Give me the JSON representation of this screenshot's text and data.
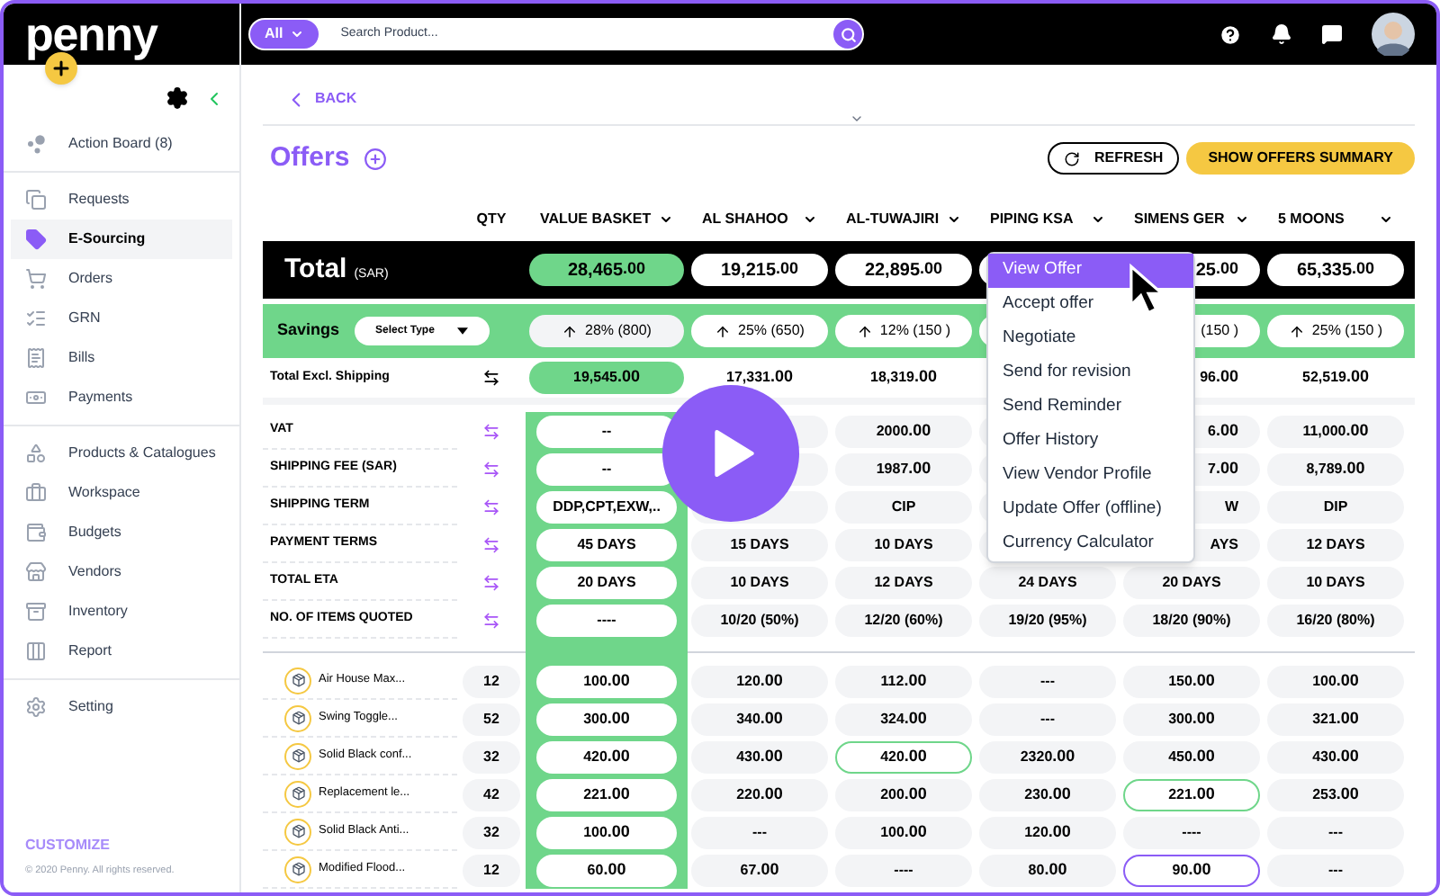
{
  "sidebar": {
    "logo": "penny",
    "groups": [
      [
        {
          "label": "Action Board (8)",
          "selected": false
        }
      ],
      [
        {
          "label": "Requests",
          "selected": false
        },
        {
          "label": "E-Sourcing",
          "selected": true
        },
        {
          "label": "Orders",
          "selected": false
        },
        {
          "label": "GRN",
          "selected": false
        },
        {
          "label": "Bills",
          "selected": false
        },
        {
          "label": "Payments",
          "selected": false
        }
      ],
      [
        {
          "label": "Products & Catalogues",
          "selected": false
        },
        {
          "label": "Workspace",
          "selected": false
        },
        {
          "label": "Budgets",
          "selected": false
        },
        {
          "label": "Vendors",
          "selected": false
        },
        {
          "label": "Inventory",
          "selected": false
        },
        {
          "label": "Report",
          "selected": false
        }
      ],
      [
        {
          "label": "Setting",
          "selected": false
        }
      ]
    ],
    "customize": "CUSTOMIZE",
    "copyright": "© 2020 Penny. All rights reserved."
  },
  "topbar": {
    "scope": "All",
    "placeholder": "Search Product..."
  },
  "page": {
    "back": "BACK",
    "title": "Offers",
    "refresh": "REFRESH",
    "summary": "SHOW OFFERS SUMMARY"
  },
  "table": {
    "qty_heading": "QTY",
    "columns": [
      "VALUE BASKET",
      "AL SHAHOO",
      "AL-TUWAJIRI",
      "PIPING KSA",
      "SIMENS GER",
      "5 MOONS"
    ],
    "total": {
      "label": "Total",
      "unit": "(SAR)",
      "values": {
        "value_basket": "28,465.00",
        "al_shahoo": "19,215.00",
        "al_tuwajiri": "22,895.00",
        "simens_ger": {
          "text": "25.00",
          "clipped": true
        },
        "five_moons": "65,335.00"
      }
    },
    "savings": {
      "label": "Savings",
      "select": "Select Type",
      "values": {
        "value_basket": {
          "text": "28% (800)",
          "arrow": true
        },
        "al_shahoo": {
          "text": "25% (650)",
          "arrow": true
        },
        "al_tuwajiri": {
          "text": "12% (150 )",
          "arrow": true
        },
        "simens_ger": {
          "text": "(150 )",
          "clipped": true
        },
        "five_moons": {
          "text": "25% (150 )",
          "arrow": true
        }
      }
    },
    "excl_shipping": {
      "label": "Total Excl. Shipping",
      "values": {
        "value_basket": "19,545.00",
        "al_shahoo": "17,331.00",
        "al_tuwajiri": "18,319.00",
        "simens_ger": {
          "text": "96.00",
          "clipped": true
        },
        "five_moons": "52,519.00"
      }
    },
    "terms": [
      {
        "label": "VAT",
        "values": {
          "value_basket": "--",
          "al_tuwajiri": "2000.00",
          "simens_ger": {
            "text": "6.00",
            "clipped": true
          },
          "five_moons": "11,000.00"
        }
      },
      {
        "label": "SHIPPING FEE (SAR)",
        "values": {
          "value_basket": "--",
          "al_tuwajiri": "1987.00",
          "simens_ger": {
            "text": "7.00",
            "clipped": true
          },
          "five_moons": "8,789.00"
        }
      },
      {
        "label": "SHIPPING TERM",
        "values": {
          "value_basket": "DDP,CPT,EXW,..",
          "al_tuwajiri": "CIP",
          "simens_ger": {
            "text": "W",
            "clipped": true
          },
          "five_moons": "DIP"
        }
      },
      {
        "label": "PAYMENT TERMS",
        "values": {
          "value_basket": "45 DAYS",
          "al_shahoo": "15 DAYS",
          "al_tuwajiri": "10 DAYS",
          "simens_ger": {
            "text": "AYS",
            "clipped": true
          },
          "five_moons": "12 DAYS"
        }
      },
      {
        "label": "TOTAL ETA",
        "values": [
          "20 DAYS",
          "10 DAYS",
          "12 DAYS",
          "24 DAYS",
          "20 DAYS",
          "10 DAYS"
        ]
      },
      {
        "label": "NO. OF ITEMS QUOTED",
        "values": [
          "----",
          "10/20 (50%)",
          "12/20 (60%)",
          "19/20 (95%)",
          "18/20 (90%)",
          "16/20 (80%)"
        ]
      }
    ],
    "items": [
      {
        "name": "Air House Max...",
        "qty": "12",
        "values": [
          "100.00",
          "120.00",
          "112.00",
          "---",
          "150.00",
          "100.00"
        ]
      },
      {
        "name": "Swing Toggle...",
        "qty": "52",
        "values": [
          "300.00",
          "340.00",
          "324.00",
          "---",
          "300.00",
          "321.00"
        ]
      },
      {
        "name": "Solid Black conf...",
        "qty": "32",
        "values": [
          "420.00",
          "430.00",
          {
            "text": "420.00",
            "color": "#6fd68a"
          },
          "2320.00",
          "450.00",
          "430.00"
        ]
      },
      {
        "name": "Replacement le...",
        "qty": "42",
        "values": [
          "221.00",
          "220.00",
          "200.00",
          "230.00",
          {
            "text": "221.00",
            "color": "#6fd68a"
          },
          "253.00"
        ]
      },
      {
        "name": "Solid Black Anti...",
        "qty": "32",
        "values": [
          "100.00",
          "---",
          "100.00",
          "120.00",
          "----",
          "---"
        ]
      },
      {
        "name": "Modified Flood...",
        "qty": "12",
        "values": [
          "60.00",
          "67.00",
          "----",
          "80.00",
          {
            "text": "90.00",
            "color": "#8b5cf6"
          },
          "---"
        ]
      }
    ]
  },
  "menu": [
    {
      "label": "View Offer",
      "selected": true
    },
    {
      "label": "Accept offer",
      "selected": false
    },
    {
      "label": "Negotiate",
      "selected": false
    },
    {
      "label": "Send for revision",
      "selected": false
    },
    {
      "label": "Send Reminder",
      "selected": false
    },
    {
      "label": "Offer History",
      "selected": false
    },
    {
      "label": "View Vendor Profile",
      "selected": false
    },
    {
      "label": "Update Offer (offline)",
      "selected": false
    },
    {
      "label": "Currency Calculator",
      "selected": false
    }
  ]
}
